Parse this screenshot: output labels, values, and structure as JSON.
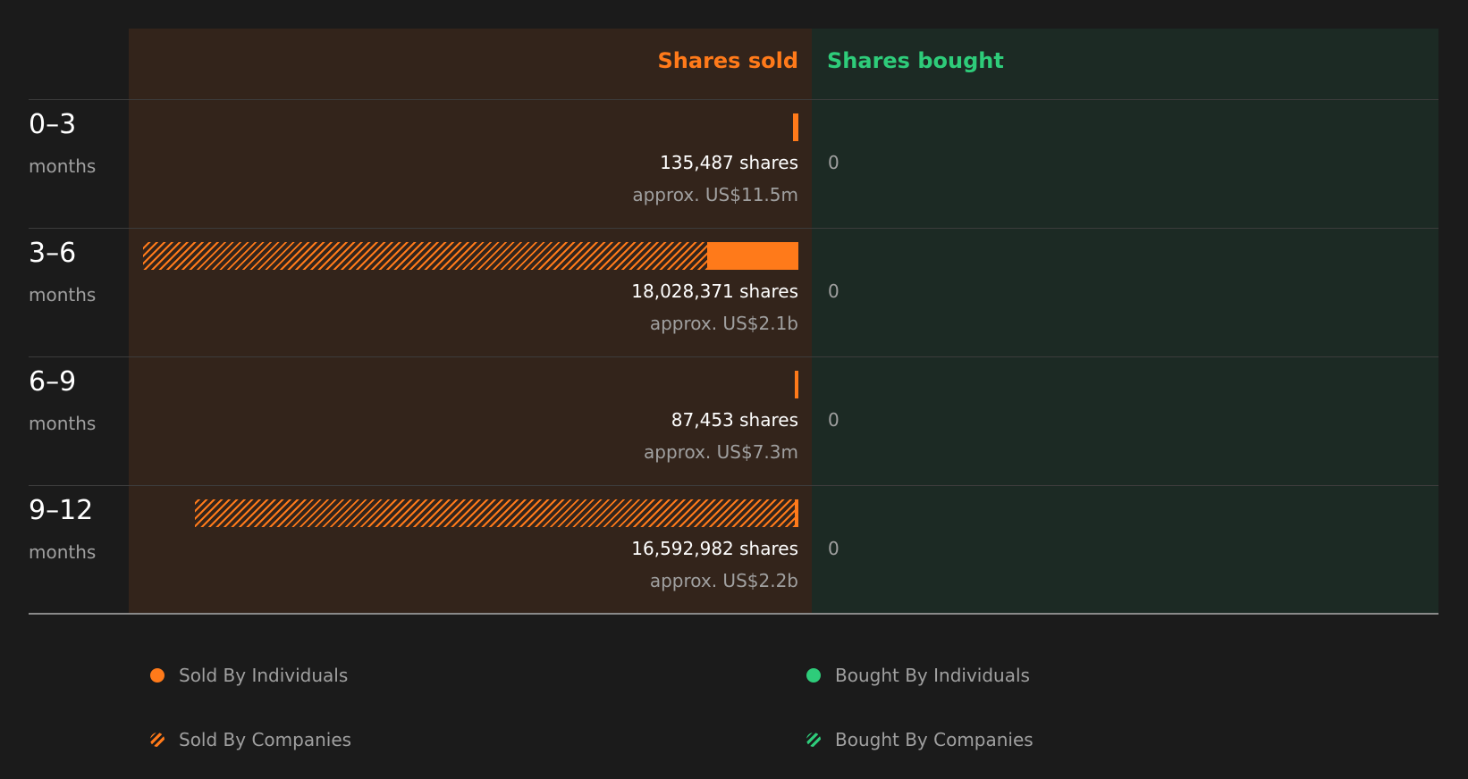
{
  "chart_data": {
    "type": "bar",
    "headers": {
      "sold": "Shares sold",
      "bought": "Shares bought"
    },
    "categories": [
      "0-3",
      "3-6",
      "6-9",
      "9-12"
    ],
    "unit_label": "months",
    "rows": [
      {
        "period": "0–3",
        "unit": "months",
        "sold_shares": 135487,
        "sold_ind": 135487,
        "sold_comp": 0,
        "shares_text": "135,487 shares",
        "approx_text": "approx. US$11.5m",
        "bought_text": "0"
      },
      {
        "period": "3–6",
        "unit": "months",
        "sold_shares": 18028371,
        "sold_ind": 2500000,
        "sold_comp": 15528371,
        "shares_text": "18,028,371 shares",
        "approx_text": "approx. US$2.1b",
        "bought_text": "0"
      },
      {
        "period": "6–9",
        "unit": "months",
        "sold_shares": 87453,
        "sold_ind": 87453,
        "sold_comp": 0,
        "shares_text": "87,453 shares",
        "approx_text": "approx. US$7.3m",
        "bought_text": "0"
      },
      {
        "period": "9–12",
        "unit": "months",
        "sold_shares": 16592982,
        "sold_ind": 90000,
        "sold_comp": 16502982,
        "shares_text": "16,592,982 shares",
        "approx_text": "approx. US$2.2b",
        "bought_text": "0"
      }
    ],
    "series": [
      {
        "name": "Sold By Individuals",
        "values": [
          135487,
          2500000,
          87453,
          90000
        ]
      },
      {
        "name": "Sold By Companies",
        "values": [
          0,
          15528371,
          0,
          16502982
        ]
      },
      {
        "name": "Bought By Individuals",
        "values": [
          0,
          0,
          0,
          0
        ]
      },
      {
        "name": "Bought By Companies",
        "values": [
          0,
          0,
          0,
          0
        ]
      }
    ],
    "max_value": 18028371,
    "legend": [
      {
        "label": "Sold By Individuals",
        "color": "#ff7a1a",
        "style": "solid"
      },
      {
        "label": "Bought By Individuals",
        "color": "#2ecc7a",
        "style": "solid"
      },
      {
        "label": "Sold By Companies",
        "color": "#ff7a1a",
        "style": "hatched"
      },
      {
        "label": "Bought By Companies",
        "color": "#2ecc7a",
        "style": "hatched"
      }
    ],
    "legend_placement": "bottom"
  },
  "colors": {
    "sold": "#ff7a1a",
    "bought": "#2ecc7a",
    "sold_panel": "#33241b",
    "bought_panel": "#1c2a24",
    "background": "#1b1b1b"
  }
}
